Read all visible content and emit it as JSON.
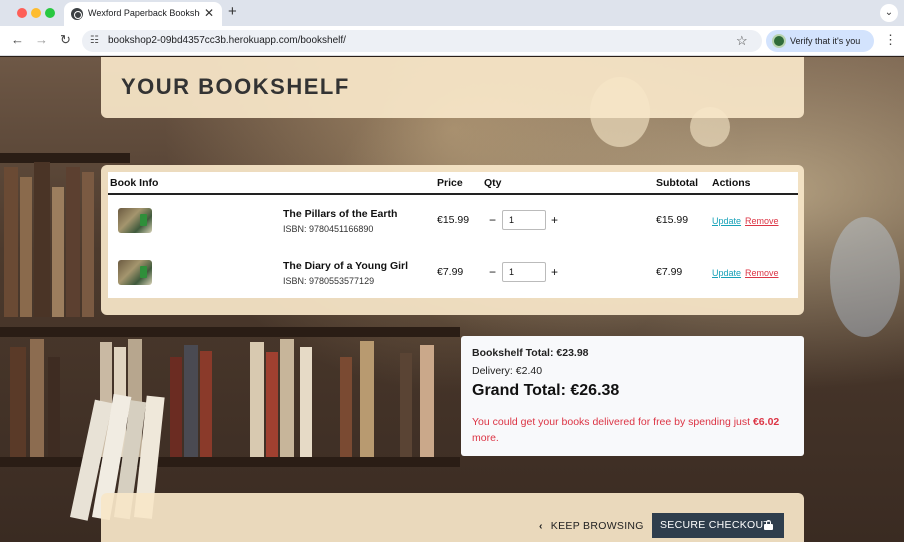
{
  "browser": {
    "tab_title": "Wexford Paperback Bookshop",
    "tab_close": "✕",
    "new_tab": "+",
    "url": "bookshop2-09bd4357cc3b.herokuapp.com/bookshelf/",
    "verify_label": "Verify that it's you",
    "nav_back": "←",
    "nav_forward": "→",
    "nav_reload": "↻",
    "star_icon": "☆",
    "menu_icon": "⋮",
    "tab_menu_icon": "⌄"
  },
  "page": {
    "title": "YOUR BOOKSHELF"
  },
  "table": {
    "headers": {
      "book_info": "Book Info",
      "price": "Price",
      "qty": "Qty",
      "subtotal": "Subtotal",
      "actions": "Actions"
    },
    "rows": [
      {
        "title": "The Pillars of the Earth",
        "isbn": "ISBN: 9780451166890",
        "price": "€15.99",
        "qty": "1",
        "subtotal": "€15.99",
        "update": "Update",
        "remove": "Remove"
      },
      {
        "title": "The Diary of a Young Girl",
        "isbn": "ISBN: 9780553577129",
        "price": "€7.99",
        "qty": "1",
        "subtotal": "€7.99",
        "update": "Update",
        "remove": "Remove"
      }
    ],
    "minus": "−",
    "plus": "+"
  },
  "summary": {
    "bookshelf_total": "Bookshelf Total: €23.98",
    "delivery": "Delivery: €2.40",
    "grand_total": "Grand Total: €26.38",
    "free_delivery_prefix": "You could get your books delivered for free by spending just ",
    "free_delivery_amount": "€6.02",
    "free_delivery_suffix": " more."
  },
  "footer": {
    "keep_browsing": "KEEP BROWSING",
    "keep_browsing_icon": "‹",
    "secure_checkout": "SECURE CHECKOUT"
  },
  "colors": {
    "accent_link": "#17a2b8",
    "danger": "#dc3545",
    "checkout_button": "#2f3e4d",
    "card_beige": "#f7e6c8"
  }
}
